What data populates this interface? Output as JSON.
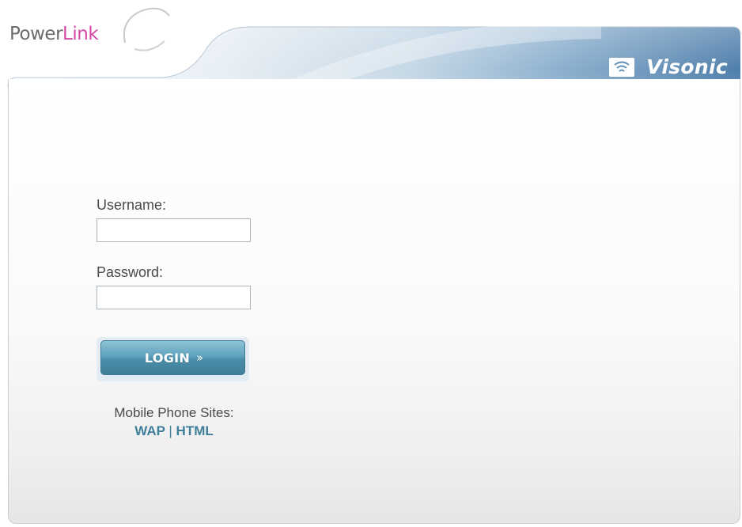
{
  "header": {
    "logo": {
      "prefix": "Power",
      "accent": "Link"
    },
    "brand": "Visonic"
  },
  "form": {
    "username_label": "Username:",
    "username_value": "",
    "password_label": "Password:",
    "password_value": "",
    "login_label": "LOGIN",
    "login_icon": "double-chevron-right-icon"
  },
  "mobile": {
    "title": "Mobile Phone Sites:",
    "links": {
      "wap": "WAP",
      "separator": "|",
      "html": "HTML"
    }
  },
  "colors": {
    "header_blue": "#5e8fb8",
    "link_teal": "#3f7f99",
    "logo_pink": "#d64aa6",
    "button_blue": "#5fa2bd"
  }
}
